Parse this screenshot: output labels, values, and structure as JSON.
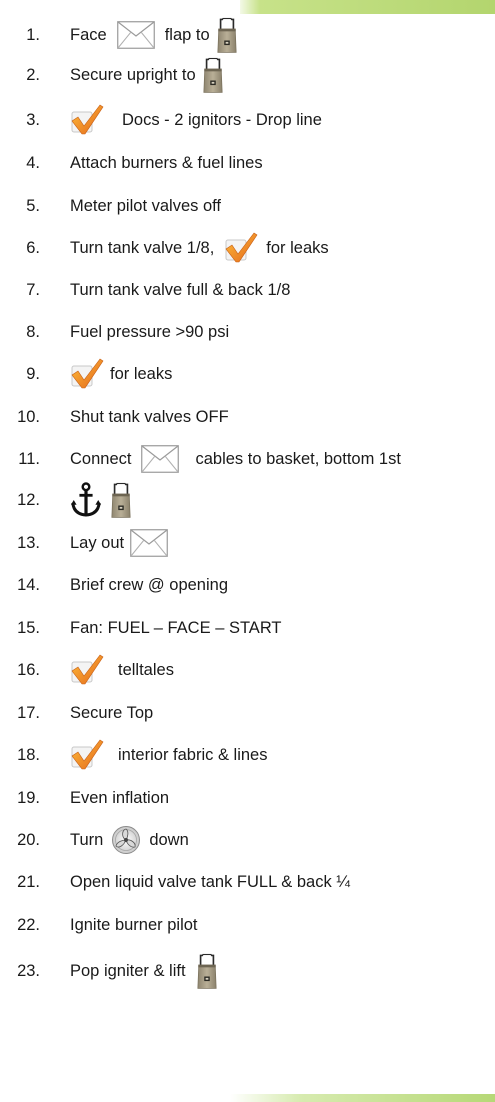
{
  "checklist": [
    {
      "num": "1.",
      "text_a": "Face",
      "text_b": "flap to"
    },
    {
      "num": "2.",
      "text_a": "Secure upright to"
    },
    {
      "num": "3.",
      "text_a": "Docs - 2 ignitors - Drop line"
    },
    {
      "num": "4.",
      "text_a": "Attach burners & fuel lines"
    },
    {
      "num": "5.",
      "text_a": "Meter pilot valves off"
    },
    {
      "num": "6.",
      "text_a": "Turn tank valve 1/8,",
      "text_b": "for leaks"
    },
    {
      "num": "7.",
      "text_a": "Turn tank valve full & back 1/8"
    },
    {
      "num": "8.",
      "text_a": "Fuel pressure >90 psi"
    },
    {
      "num": "9.",
      "text_a": "for leaks"
    },
    {
      "num": "10.",
      "text_a": "Shut tank valves OFF"
    },
    {
      "num": "11.",
      "text_a": "Connect",
      "text_b": "cables to basket, bottom 1st"
    },
    {
      "num": "12."
    },
    {
      "num": "13.",
      "text_a": "Lay out"
    },
    {
      "num": "14.",
      "text_a": "Brief crew @ opening"
    },
    {
      "num": "15.",
      "text_a": "Fan: FUEL – FACE – START"
    },
    {
      "num": "16.",
      "text_a": "telltales"
    },
    {
      "num": "17.",
      "text_a": "Secure Top"
    },
    {
      "num": "18.",
      "text_a": "interior fabric & lines"
    },
    {
      "num": "19.",
      "text_a": "Even inflation"
    },
    {
      "num": "20.",
      "text_a": "Turn",
      "text_b": "down"
    },
    {
      "num": "21.",
      "text_a": "Open liquid valve tank FULL & back ¼"
    },
    {
      "num": "22.",
      "text_a": "Ignite burner pilot"
    },
    {
      "num": "23.",
      "text_a": "Pop igniter & lift"
    }
  ],
  "icons": {
    "envelope": "envelope-icon",
    "basket": "basket-icon",
    "check": "checkmark-icon",
    "anchor": "anchor-icon",
    "fan": "fan-icon"
  },
  "colors": {
    "header_green": "#b3d56e",
    "check_orange": "#f08a1c",
    "basket_khaki": "#a79c84"
  }
}
